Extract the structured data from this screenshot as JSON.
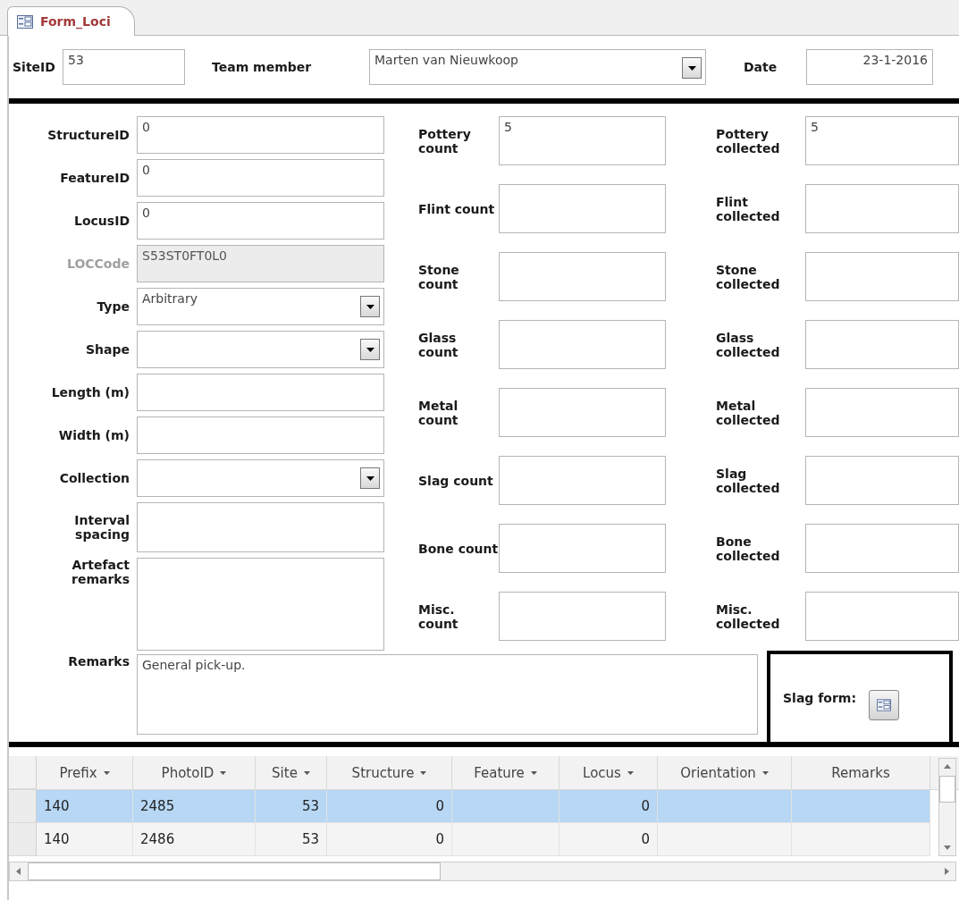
{
  "tab": {
    "label": "Form_Loci",
    "selected": true
  },
  "header": {
    "site_id": {
      "label": "SiteID",
      "value": "53"
    },
    "team_member": {
      "label": "Team member",
      "value": "Marten van Nieuwkoop"
    },
    "date": {
      "label": "Date",
      "value": "23-1-2016"
    }
  },
  "left_fields": [
    {
      "label": "StructureID",
      "value": "0",
      "kind": "text",
      "disabled": false
    },
    {
      "label": "FeatureID",
      "value": "0",
      "kind": "text",
      "disabled": false
    },
    {
      "label": "LocusID",
      "value": "0",
      "kind": "text",
      "disabled": false
    },
    {
      "label": "LOCCode",
      "value": "S53ST0FT0L0",
      "kind": "text",
      "disabled": true
    },
    {
      "label": "Type",
      "value": "Arbitrary",
      "kind": "combo",
      "disabled": false
    },
    {
      "label": "Shape",
      "kind": "combo",
      "disabled": false
    },
    {
      "label": "Length (m)",
      "kind": "text",
      "disabled": false
    },
    {
      "label": "Width (m)",
      "kind": "text",
      "disabled": false
    },
    {
      "label": "Collection",
      "kind": "combo",
      "disabled": false
    },
    {
      "label": "Interval spacing",
      "kind": "tall",
      "disabled": false
    },
    {
      "label": "Artefact remarks",
      "kind": "memo",
      "disabled": false
    }
  ],
  "count_fields": [
    {
      "label": "Pottery count",
      "value": "5"
    },
    {
      "label": "Flint count"
    },
    {
      "label": "Stone count"
    },
    {
      "label": "Glass count"
    },
    {
      "label": "Metal count"
    },
    {
      "label": "Slag count"
    },
    {
      "label": "Bone count"
    },
    {
      "label": "Misc. count"
    }
  ],
  "collected_fields": [
    {
      "label": "Pottery collected",
      "value": "5"
    },
    {
      "label": "Flint collected"
    },
    {
      "label": "Stone collected"
    },
    {
      "label": "Glass collected"
    },
    {
      "label": "Metal collected"
    },
    {
      "label": "Slag collected"
    },
    {
      "label": "Bone collected"
    },
    {
      "label": "Misc. collected"
    }
  ],
  "remarks": {
    "label": "Remarks",
    "value": "General pick-up."
  },
  "slag_form": {
    "label": "Slag form:"
  },
  "datasheet": {
    "columns": [
      {
        "label": "Prefix",
        "dropdown": true,
        "kind": "text"
      },
      {
        "label": "PhotoID",
        "dropdown": true,
        "kind": "text"
      },
      {
        "label": "Site",
        "dropdown": true,
        "kind": "number"
      },
      {
        "label": "Structure",
        "dropdown": true,
        "kind": "number"
      },
      {
        "label": "Feature",
        "dropdown": true,
        "kind": "text"
      },
      {
        "label": "Locus",
        "dropdown": true,
        "kind": "number"
      },
      {
        "label": "Orientation",
        "dropdown": true,
        "kind": "text"
      },
      {
        "label": "Remarks",
        "dropdown": false,
        "kind": "text"
      }
    ],
    "rows": [
      {
        "selected": true,
        "cells": [
          "140",
          "2485",
          "53",
          "0",
          "",
          "0",
          "",
          ""
        ]
      },
      {
        "selected": false,
        "cells": [
          "140",
          "2486",
          "53",
          "0",
          "",
          "0",
          "",
          ""
        ]
      }
    ]
  }
}
